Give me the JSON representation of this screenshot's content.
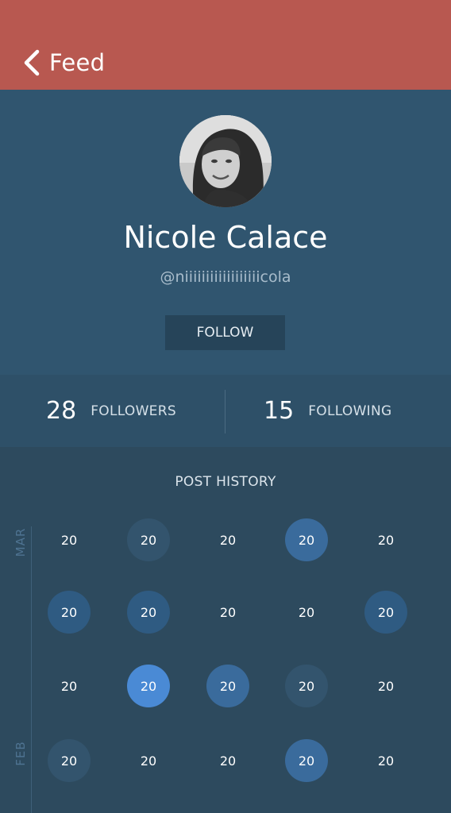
{
  "navbar": {
    "back_label": "Feed",
    "back_icon": "chevron-left-icon",
    "color": "#b85850"
  },
  "profile": {
    "name": "Nicole Calace",
    "handle": "@niiiiiiiiiiiiiiiiiicola",
    "follow_label": "FOLLOW"
  },
  "stats": {
    "followers_count": "28",
    "followers_label": "FOLLOWERS",
    "following_count": "15",
    "following_label": "FOLLOWING"
  },
  "post_history": {
    "title": "POST HISTORY",
    "months": [
      "MAR",
      "FEB"
    ],
    "rows": [
      [
        {
          "label": "20",
          "level": 0
        },
        {
          "label": "20",
          "level": 1
        },
        {
          "label": "20",
          "level": 0
        },
        {
          "label": "20",
          "level": 3
        },
        {
          "label": "20",
          "level": 0
        }
      ],
      [
        {
          "label": "20",
          "level": 2
        },
        {
          "label": "20",
          "level": 2
        },
        {
          "label": "20",
          "level": 0
        },
        {
          "label": "20",
          "level": 0
        },
        {
          "label": "20",
          "level": 2
        }
      ],
      [
        {
          "label": "20",
          "level": 0
        },
        {
          "label": "20",
          "level": 4
        },
        {
          "label": "20",
          "level": 3
        },
        {
          "label": "20",
          "level": 1
        },
        {
          "label": "20",
          "level": 0
        }
      ],
      [
        {
          "label": "20",
          "level": 1
        },
        {
          "label": "20",
          "level": 0
        },
        {
          "label": "20",
          "level": 0
        },
        {
          "label": "20",
          "level": 3
        },
        {
          "label": "20",
          "level": 0
        }
      ]
    ]
  }
}
